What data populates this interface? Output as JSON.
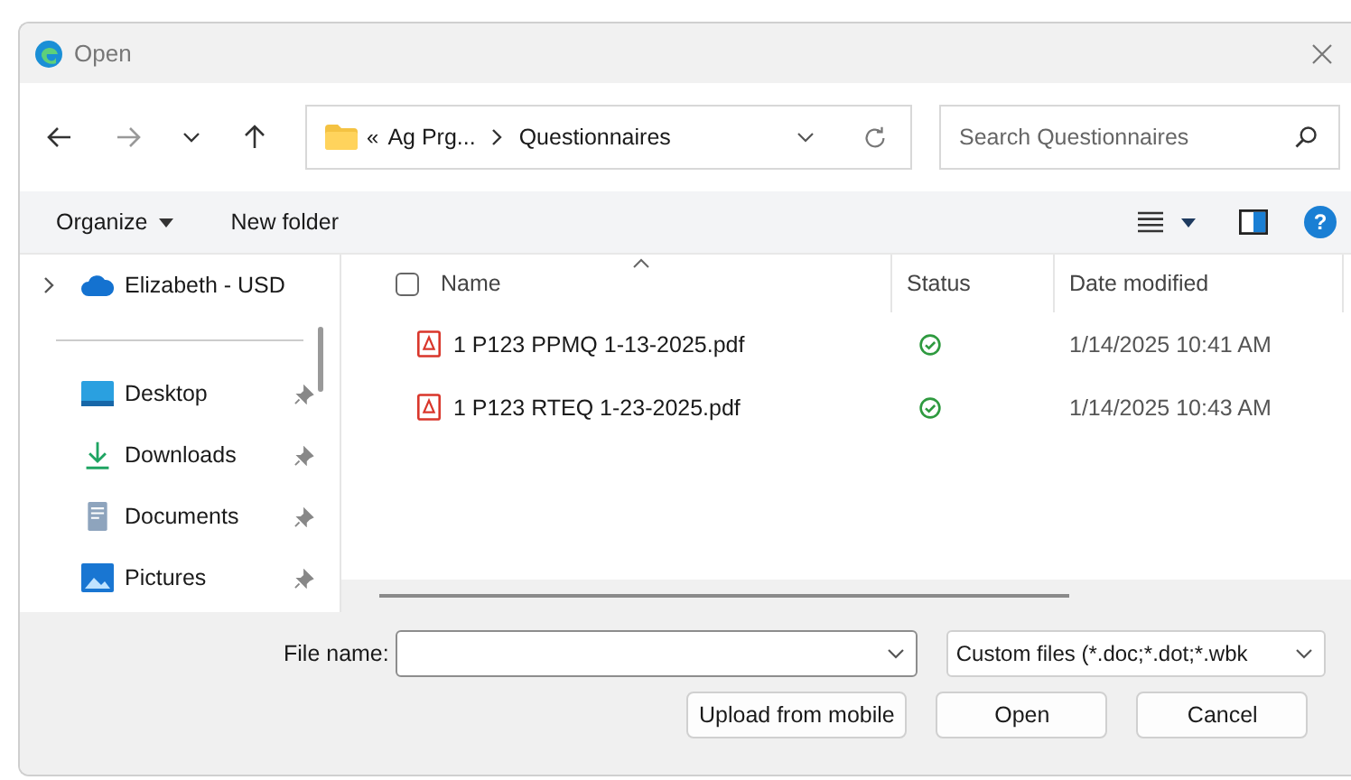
{
  "window": {
    "title": "Open"
  },
  "address": {
    "overflow": "«",
    "segments": [
      "Ag Prg...",
      "Questionnaires"
    ]
  },
  "search": {
    "placeholder": "Search Questionnaires"
  },
  "toolbar": {
    "organize": "Organize",
    "new_folder": "New folder",
    "help": "?"
  },
  "sidebar": {
    "items": [
      {
        "kind": "cloud",
        "label": "Elizabeth - USD",
        "pinned": false
      },
      {
        "kind": "divider"
      },
      {
        "kind": "desktop",
        "label": "Desktop",
        "pinned": true
      },
      {
        "kind": "downloads",
        "label": "Downloads",
        "pinned": true
      },
      {
        "kind": "documents",
        "label": "Documents",
        "pinned": true
      },
      {
        "kind": "pictures",
        "label": "Pictures",
        "pinned": true
      }
    ]
  },
  "table": {
    "select_all_checked": false,
    "columns": [
      "Name",
      "Status",
      "Date modified"
    ],
    "rows": [
      {
        "name": "1 P123 PPMQ 1-13-2025.pdf",
        "synced": true,
        "date": "1/14/2025 10:41 AM"
      },
      {
        "name": "1 P123 RTEQ 1-23-2025.pdf",
        "synced": true,
        "date": "1/14/2025 10:43 AM"
      }
    ]
  },
  "footer": {
    "file_name_label": "File name:",
    "file_type": "Custom files (*.doc;*.dot;*.wbk",
    "buttons": [
      "Upload from mobile",
      "Open",
      "Cancel"
    ]
  }
}
